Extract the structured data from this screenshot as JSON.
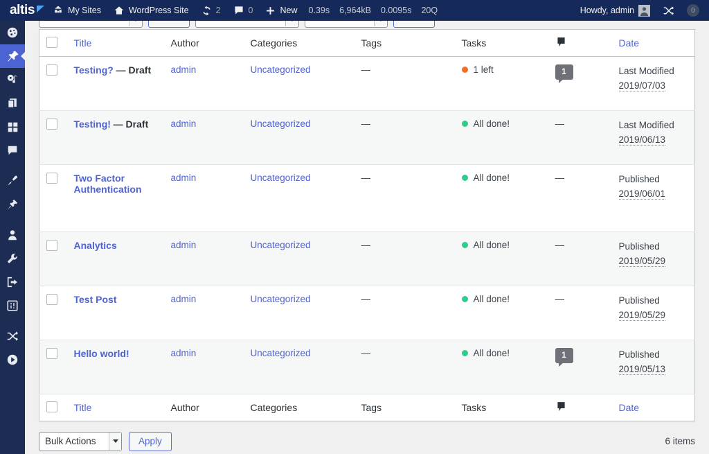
{
  "adminbar": {
    "logo": "altis",
    "my_sites": "My Sites",
    "site_name": "WordPress Site",
    "updates_count": "2",
    "comments_count": "0",
    "new_label": "New",
    "metric_time": "0.39s",
    "metric_memory": "6,964kB",
    "metric_query_time": "0.0095s",
    "metric_queries": "20Q",
    "howdy": "Howdy, admin",
    "shuffle_badge": "0"
  },
  "sidebar": {
    "items": [
      {
        "name": "dashboard",
        "icon": "dashboard-icon",
        "active": false
      },
      {
        "name": "posts",
        "icon": "pushpin-icon",
        "active": true
      },
      {
        "name": "media",
        "icon": "media-icon",
        "active": false
      },
      {
        "name": "pages",
        "icon": "pages-icon",
        "active": false
      },
      {
        "name": "grid",
        "icon": "grid-icon",
        "active": false
      },
      {
        "name": "comments",
        "icon": "comment-icon",
        "active": false
      },
      {
        "name": "appearance",
        "icon": "paintbrush-icon",
        "active": false
      },
      {
        "name": "plugins",
        "icon": "plug-icon",
        "active": false
      },
      {
        "name": "users",
        "icon": "user-icon",
        "active": false
      },
      {
        "name": "tools",
        "icon": "wrench-icon",
        "active": false
      },
      {
        "name": "export",
        "icon": "export-icon",
        "active": false
      },
      {
        "name": "settings",
        "icon": "sliders-icon",
        "active": false
      },
      {
        "name": "shuffle",
        "icon": "shuffle-icon",
        "active": false
      },
      {
        "name": "play",
        "icon": "play-icon",
        "active": false
      }
    ]
  },
  "table": {
    "columns": {
      "title": "Title",
      "author": "Author",
      "categories": "Categories",
      "tags": "Tags",
      "tasks": "Tasks",
      "comments_icon": "comment-icon",
      "date": "Date"
    },
    "rows": [
      {
        "title": "Testing?",
        "state": "— Draft",
        "author": "admin",
        "categories": "Uncategorized",
        "tags": "—",
        "task_status": "1 left",
        "task_color": "#f56e28",
        "comments": "1",
        "date_status": "Last Modified",
        "date_value": "2019/07/03"
      },
      {
        "title": "Testing!",
        "state": "— Draft",
        "author": "admin",
        "categories": "Uncategorized",
        "tags": "—",
        "task_status": "All done!",
        "task_color": "#2ecc8a",
        "comments": "—",
        "date_status": "Last Modified",
        "date_value": "2019/06/13"
      },
      {
        "title": "Two Factor Authentication",
        "state": "",
        "author": "admin",
        "categories": "Uncategorized",
        "tags": "—",
        "task_status": "All done!",
        "task_color": "#2ecc8a",
        "comments": "—",
        "date_status": "Published",
        "date_value": "2019/06/01"
      },
      {
        "title": "Analytics",
        "state": "",
        "author": "admin",
        "categories": "Uncategorized",
        "tags": "—",
        "task_status": "All done!",
        "task_color": "#2ecc8a",
        "comments": "—",
        "date_status": "Published",
        "date_value": "2019/05/29"
      },
      {
        "title": "Test Post",
        "state": "",
        "author": "admin",
        "categories": "Uncategorized",
        "tags": "—",
        "task_status": "All done!",
        "task_color": "#2ecc8a",
        "comments": "—",
        "date_status": "Published",
        "date_value": "2019/05/29"
      },
      {
        "title": "Hello world!",
        "state": "",
        "author": "admin",
        "categories": "Uncategorized",
        "tags": "—",
        "task_status": "All done!",
        "task_color": "#2ecc8a",
        "comments": "1",
        "date_status": "Published",
        "date_value": "2019/05/13"
      }
    ]
  },
  "tablenav": {
    "bulk_actions": "Bulk Actions",
    "apply": "Apply",
    "items_count": "6 items"
  },
  "colors": {
    "adminbar_bg": "#152a5b",
    "sidebar_bg": "#1d2c52",
    "accent": "#4f63d2",
    "active_item": "#4c63d2",
    "task_pending": "#f56e28",
    "task_done": "#2ecc8a"
  }
}
